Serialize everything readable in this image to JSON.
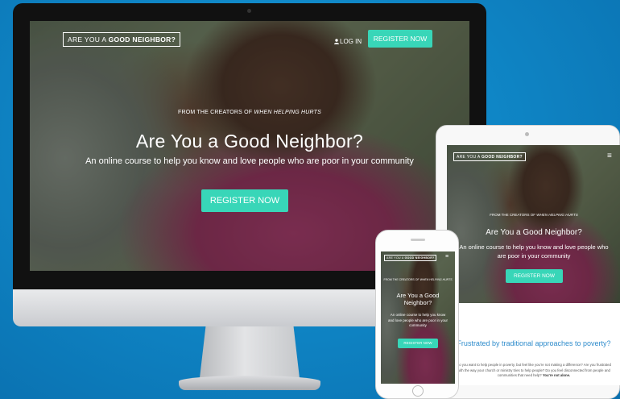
{
  "site": {
    "logo_prefix": "ARE YOU A ",
    "logo_bold": "GOOD NEIGHBOR?",
    "login_label": "LOG IN",
    "register_top_label": "REGISTER NOW",
    "from_prefix": "FROM THE CREATORS OF ",
    "from_title": "WHEN HELPING HURTS",
    "hero_title": "Are You a Good Neighbor?",
    "hero_subtitle": "An online course to help you know and love people who are poor in your community",
    "register_main_label": "REGISTER NOW",
    "menu_glyph": "≡"
  },
  "tablet": {
    "section_heading": "Frustrated by traditional approaches to poverty?",
    "section_body": "Do you want to help people in poverty, but feel like you're not making a difference? Are you frustrated with the way your church or ministry tries to help people? Do you feel disconnected from people and communities that need help? ",
    "section_body_bold": "You're not alone."
  },
  "colors": {
    "background_blue": "#0f86c6",
    "accent_teal": "#38d6b8",
    "heading_blue": "#2f8ccc"
  },
  "icons": {
    "login": "user-icon",
    "menu": "hamburger-menu-icon"
  }
}
